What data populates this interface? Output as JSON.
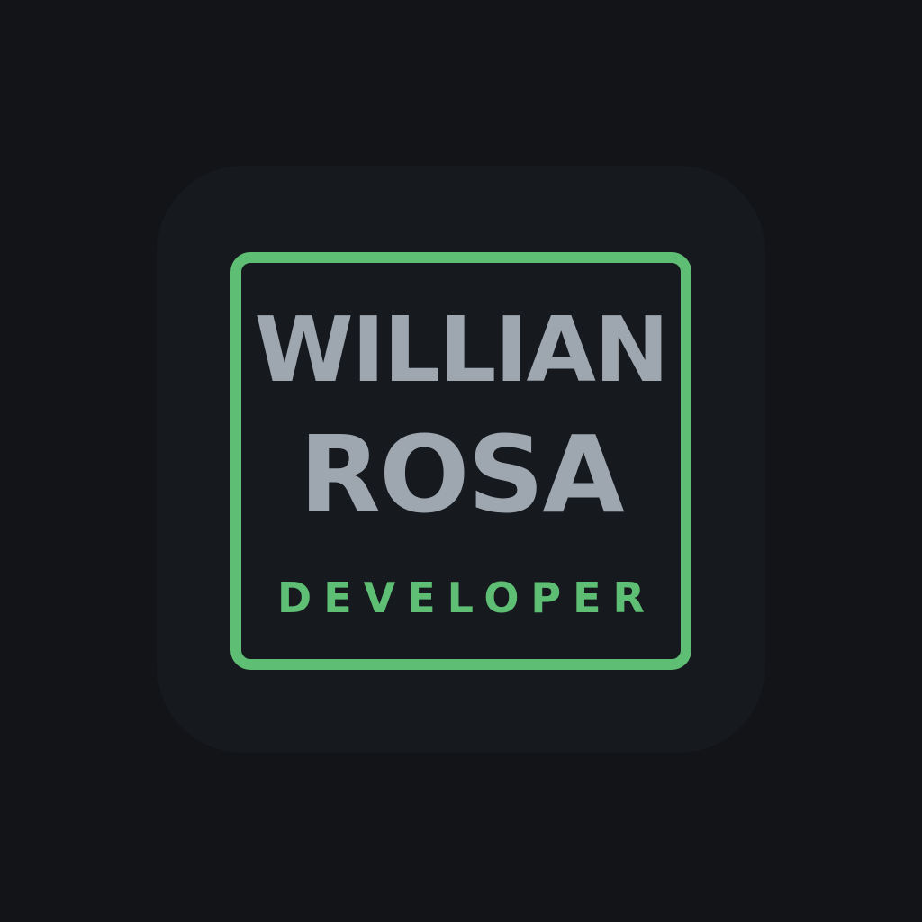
{
  "logo": {
    "first_name": "WILLIAN",
    "last_name": "ROSA",
    "role": "DEVELOPER"
  },
  "colors": {
    "page_background": "#121418",
    "tile_background": "#16191e",
    "accent": "#5dbe74",
    "name_text": "#9ea6b0"
  }
}
